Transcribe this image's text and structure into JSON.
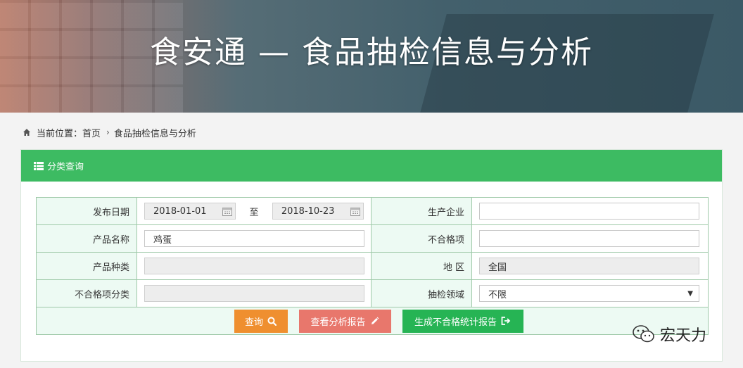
{
  "banner": {
    "title": "食安通 — 食品抽检信息与分析"
  },
  "breadcrumb": {
    "prefix": "当前位置：",
    "home": "首页",
    "separator": "›",
    "current": "食品抽检信息与分析"
  },
  "panel": {
    "header": "分类查询"
  },
  "form": {
    "publish_date": {
      "label": "发布日期",
      "from": "2018-01-01",
      "to_label": "至",
      "to": "2018-10-23"
    },
    "manufacturer": {
      "label": "生产企业",
      "value": ""
    },
    "product_name": {
      "label": "产品名称",
      "value": "鸡蛋"
    },
    "failed_item": {
      "label": "不合格项",
      "value": ""
    },
    "product_type": {
      "label": "产品种类",
      "value": ""
    },
    "region": {
      "label": "地 区",
      "value": "全国"
    },
    "failed_category": {
      "label": "不合格项分类",
      "value": ""
    },
    "inspection_field": {
      "label": "抽检领域",
      "value": "不限",
      "caret": "▼"
    }
  },
  "buttons": {
    "query": "查询",
    "view_report": "查看分析报告",
    "generate_report": "生成不合格统计报告"
  },
  "watermark": {
    "text": "宏天力"
  },
  "colors": {
    "header_green": "#3dbb62",
    "query_orange": "#ef8f2f",
    "report_red": "#e8776c",
    "generate_green": "#26b454",
    "label_bg": "#edfaf3"
  }
}
